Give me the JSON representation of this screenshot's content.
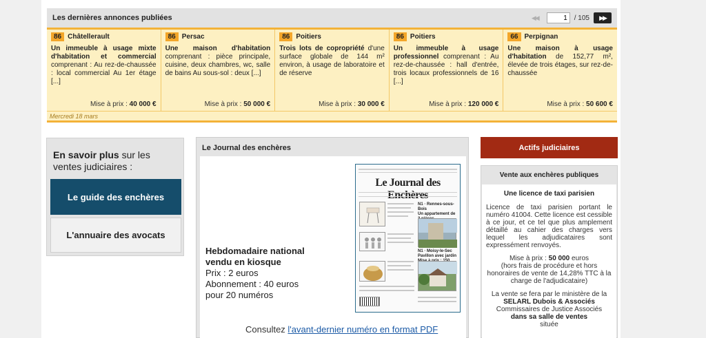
{
  "annonces": {
    "title": "Les dernières annonces publiées",
    "pager": {
      "prev": "◀◀",
      "current": "1",
      "total": "/ 105",
      "next": "▶▶"
    },
    "cards": [
      {
        "dept": "86",
        "city": "Châtellerault",
        "title": "Un immeuble à usage mixte d'habitation et commercial",
        "text": "comprenant : Au rez-de-chaussée : local commercial Au 1er étage [...]",
        "price_label": "Mise à prix : ",
        "price": "40 000 €"
      },
      {
        "dept": "86",
        "city": "Persac",
        "title": "Une maison d'habitation",
        "text": "comprenant : pièce principale, cuisine, deux chambres, wc, salle de bains Au sous-sol : deux [...]",
        "price_label": "Mise à prix : ",
        "price": "50 000 €"
      },
      {
        "dept": "86",
        "city": "Poitiers",
        "title": "Trois lots de copropriété",
        "text": "d'une surface globale de 144 m² environ, à usage de laboratoire et de réserve",
        "price_label": "Mise à prix : ",
        "price": "30 000 €"
      },
      {
        "dept": "86",
        "city": "Poitiers",
        "title": "Un immeuble à usage professionnel",
        "text": "comprenant : Au rez-de-chaussée : hall d'entrée, trois locaux professionnels de 16 [...]",
        "price_label": "Mise à prix : ",
        "price": "120 000 €"
      },
      {
        "dept": "66",
        "city": "Perpignan",
        "title": "Une maison à usage d'habitation",
        "text": "de 152,77 m², élevée de trois étages, sur rez-de-chaussée",
        "price_label": "Mise à prix : ",
        "price": "50 600 €"
      }
    ],
    "date": "Mercredi 18 mars"
  },
  "savoir": {
    "bold": "En savoir plus",
    "rest": " sur les ventes judiciaires :",
    "guide_button": "Le guide des enchères",
    "annuaire_button": "L'annuaire des avocats"
  },
  "journal": {
    "title": "Le Journal des enchères",
    "desc_line1": "Hebdomadaire national",
    "desc_line2": "vendu en kiosque",
    "price": "Prix : 2 euros",
    "abonnement": "Abonnement : 40 euros",
    "numeros": "pour 20 numéros",
    "consult": "Consultez ",
    "link": "l'avant-dernier numéro en format PDF",
    "cover_title": "Le Journal des Enchères"
  },
  "sidebar": {
    "actifs_button": "Actifs judiciaires",
    "vente_title": "Vente aux enchères publiques",
    "vente_heading": "Une licence de taxi parisien",
    "vente_desc": "Licence de taxi parisien portant le numéro 41004. Cette licence est cessible à ce jour, et ce tel que plus amplement détaillé au cahier des charges vers lequel les adjudicataires sont expressément renvoyés.",
    "price_label": "Mise à prix : ",
    "price_value": "50 000",
    "price_unit": " euros",
    "price_note": "(hors frais de procédure et hors honoraires de vente de 14,28% TTC à la charge de l'adjudicataire)",
    "sale_line1": "La vente se fera par le ministère de la",
    "sale_company": "SELARL Dubois & Associés",
    "sale_line2": "Commissaires de Justice Associés",
    "sale_place": "dans sa salle de ventes",
    "sale_line3": "située"
  }
}
